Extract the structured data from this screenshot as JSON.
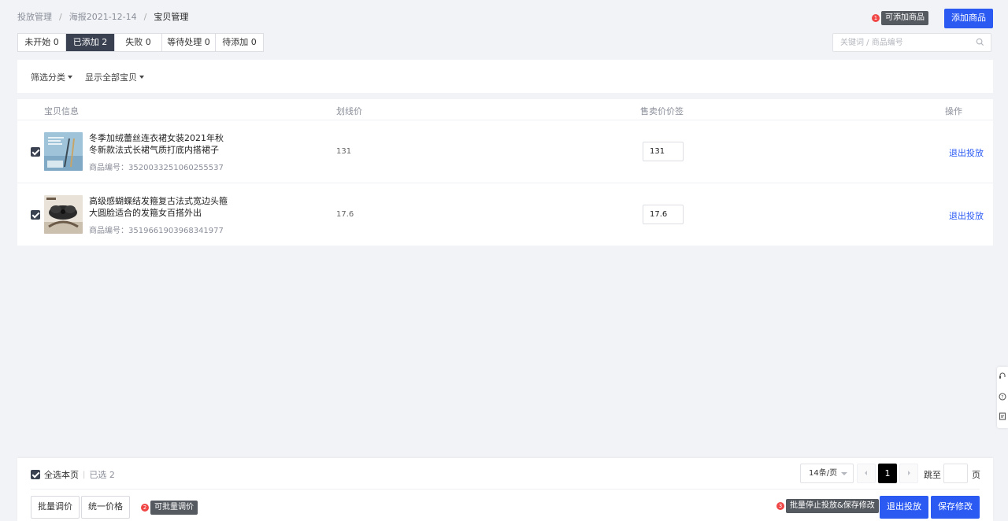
{
  "breadcrumb": {
    "items": [
      "投放管理",
      "海报2021-12-14",
      "宝贝管理"
    ],
    "separator": "/"
  },
  "header": {
    "tip1": {
      "num": "1",
      "text": "可添加商品"
    },
    "add_button": "添加商品"
  },
  "tabs": [
    {
      "label": "未开始 0",
      "active": false
    },
    {
      "label": "已添加 2",
      "active": true
    },
    {
      "label": "失败 0",
      "active": false
    },
    {
      "label": "等待处理 0",
      "active": false
    },
    {
      "label": "待添加 0",
      "active": false
    }
  ],
  "search": {
    "placeholder": "关键词 / 商品编号",
    "icon": "search-icon"
  },
  "filters": {
    "category": "筛选分类",
    "display": "显示全部宝贝"
  },
  "table": {
    "headers": {
      "info": "宝贝信息",
      "orig_price": "划线价",
      "sale_price": "售卖价价签",
      "action": "操作"
    },
    "rows": [
      {
        "checked": true,
        "title": "冬季加绒蕾丝连衣裙女装2021年秋冬新款法式长裙气质打底内搭裙子",
        "id_label": "商品编号：",
        "id": "3520033251060255537",
        "orig_price": "131",
        "sale_price": "131",
        "action": "退出投放"
      },
      {
        "checked": true,
        "title": "高级感蝴蝶结发箍复古法式宽边头箍大圆脸适合的发箍女百搭外出",
        "id_label": "商品编号：",
        "id": "3519661903968341977",
        "orig_price": "17.6",
        "sale_price": "17.6",
        "action": "退出投放"
      }
    ]
  },
  "footer": {
    "select_all": "全选本页",
    "selected": "已选 2",
    "page_size": "14条/页",
    "current_page": "1",
    "jump_to": "跳至",
    "page_unit": "页",
    "batch_adjust": "批量调价",
    "unify_price": "统一价格",
    "tip2": {
      "num": "2",
      "text": "可批量调价"
    },
    "tip3": {
      "num": "3",
      "text": "批量停止投放&保存修改"
    },
    "exit_button": "退出投放",
    "save_button": "保存修改"
  },
  "colors": {
    "primary": "#2b5af3",
    "tab_active": "#3a4150",
    "tip_dot": "#f04646",
    "background": "#f2f3f7"
  }
}
